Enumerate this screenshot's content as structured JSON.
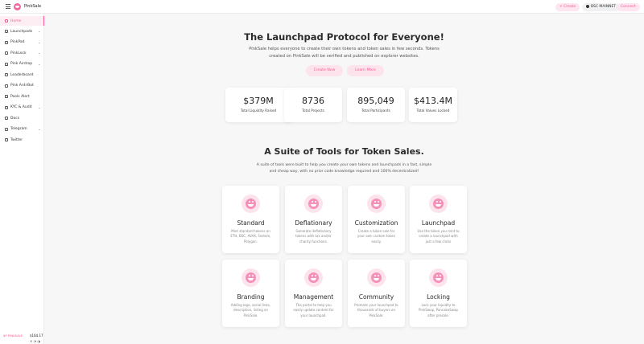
{
  "app": {
    "brand": "PinkSale"
  },
  "header": {
    "create_label": "+ Create",
    "network_label": "BSC MAINNET",
    "connect_label": "Connect"
  },
  "sidebar": {
    "items": [
      {
        "label": "Home",
        "has_chevron": false
      },
      {
        "label": "Launchpads",
        "has_chevron": true
      },
      {
        "label": "PinkPad",
        "has_chevron": true
      },
      {
        "label": "PinkLock",
        "has_chevron": true
      },
      {
        "label": "Pink Airdrop",
        "has_chevron": true
      },
      {
        "label": "Leaderboard",
        "has_chevron": false
      },
      {
        "label": "Pink Anti-Bot",
        "has_chevron": false
      },
      {
        "label": "Pools Alert",
        "has_chevron": false
      },
      {
        "label": "KYC & Audit",
        "has_chevron": true
      },
      {
        "label": "Docs",
        "has_chevron": false
      },
      {
        "label": "Telegram",
        "has_chevron": true
      },
      {
        "label": "Twitter",
        "has_chevron": false
      }
    ],
    "chevron": "⌄",
    "price_label": "$P PINKSALE",
    "price_value": "$164.17",
    "socials": "✕ ◔ ◑"
  },
  "hero": {
    "title": "The Launchpad Protocol for Everyone!",
    "description": "PinkSale helps everyone to create their own tokens and token sales in few seconds. Tokens created on PinkSale will be verified and published on explorer websites.",
    "create_now_label": "Create Now",
    "learn_more_label": "Learn More"
  },
  "stats": [
    {
      "value": "$379M",
      "label": "Total Liquidity Raised"
    },
    {
      "value": "8736",
      "label": "Total Projects"
    },
    {
      "value": "895,049",
      "label": "Total Participants"
    },
    {
      "value": "$413.4M",
      "label": "Total Values Locked"
    }
  ],
  "tools": {
    "title": "A Suite of Tools for Token Sales.",
    "description": "A suite of tools were built to help you create your own tokens and launchpads in a fast, simple and cheap way, with no prior code knowledge required and 100% decentralized!",
    "cards": [
      {
        "title": "Standard",
        "desc": "Mint standard tokens on ETH, BSC, AVAX, Fantom, Polygon."
      },
      {
        "title": "Deflationary",
        "desc": "Generate deflationary tokens with tax and/or charity functions."
      },
      {
        "title": "Customization",
        "desc": "Create a token sale for your own custom token easily."
      },
      {
        "title": "Launchpad",
        "desc": "Use the token you mint to create a launchpad with just a few clicks"
      },
      {
        "title": "Branding",
        "desc": "Adding logo, social links, description, listing on PinkSale."
      },
      {
        "title": "Management",
        "desc": "The portal to help you easily update content for your launchpad."
      },
      {
        "title": "Community",
        "desc": "Promote your launchpad to thousands of buyers on PinkSale."
      },
      {
        "title": "Locking",
        "desc": "Lock your liquidity to PinkSwap, PancakeSwap after presale."
      }
    ]
  },
  "colors": {
    "accent": "#f95997",
    "accent_light": "#fde3ec",
    "background": "#f7f7f8"
  }
}
